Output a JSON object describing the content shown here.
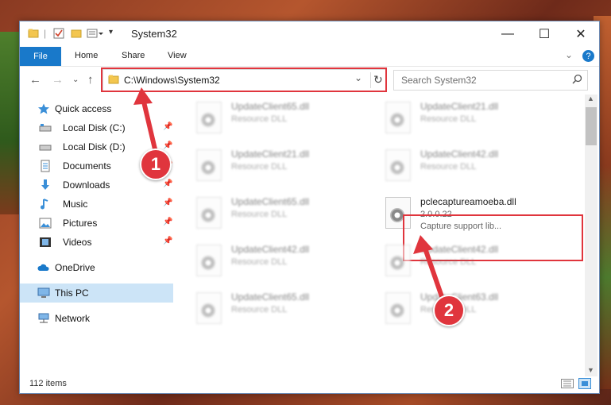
{
  "window": {
    "title": "System32",
    "minimize": "—",
    "maximize": "☐",
    "close": "✕"
  },
  "ribbon": {
    "file": "File",
    "home": "Home",
    "share": "Share",
    "view": "View"
  },
  "address": {
    "path": "C:\\Windows\\System32",
    "refresh": "↻",
    "dropdown": "⌄"
  },
  "search": {
    "placeholder": "Search System32"
  },
  "sidebar": {
    "quick_access": "Quick access",
    "items": [
      {
        "label": "Local Disk (C:)",
        "icon": "drive-icon",
        "pinned": true
      },
      {
        "label": "Local Disk (D:)",
        "icon": "drive-icon",
        "pinned": true
      },
      {
        "label": "Documents",
        "icon": "documents-icon",
        "pinned": true
      },
      {
        "label": "Downloads",
        "icon": "downloads-icon",
        "pinned": true
      },
      {
        "label": "Music",
        "icon": "music-icon",
        "pinned": true
      },
      {
        "label": "Pictures",
        "icon": "pictures-icon",
        "pinned": true
      },
      {
        "label": "Videos",
        "icon": "videos-icon",
        "pinned": true
      }
    ],
    "onedrive": "OneDrive",
    "this_pc": "This PC",
    "network": "Network"
  },
  "files": [
    {
      "name": "UpdateClient65.dll",
      "type": "Resource DLL"
    },
    {
      "name": "UpdateClient21.dll",
      "type": "Resource DLL"
    },
    {
      "name": "UpdateClient21.dll",
      "type": "Resource DLL"
    },
    {
      "name": "UpdateClient42.dll",
      "type": "Resource DLL"
    },
    {
      "name": "UpdateClient65.dll",
      "type": "Resource DLL"
    },
    {
      "name": "pclecaptureamoeba.dll",
      "version": "2.0.0.22",
      "description": "Capture support lib..."
    },
    {
      "name": "UpdateClient42.dll",
      "type": "Resource DLL"
    },
    {
      "name": "UpdateClient42.dll",
      "type": "Resource DLL"
    },
    {
      "name": "UpdateClient65.dll",
      "type": "Resource DLL"
    },
    {
      "name": "UpdateClient63.dll",
      "type": "Resource DLL"
    }
  ],
  "status": {
    "count": "112 items"
  },
  "callouts": {
    "one": "1",
    "two": "2"
  },
  "colors": {
    "accent": "#1979ca",
    "highlight": "#e0353d",
    "selected": "#cce4f7"
  }
}
